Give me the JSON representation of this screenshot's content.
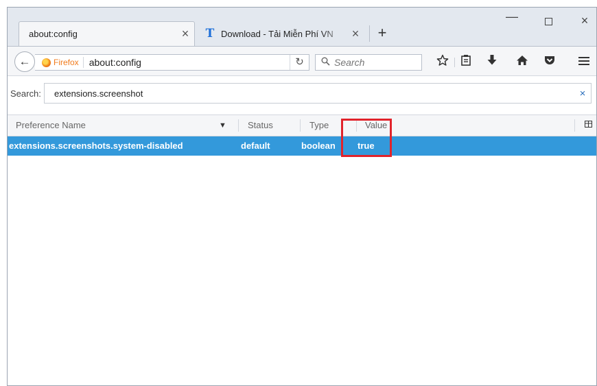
{
  "tabs": [
    {
      "title": "about:config",
      "close_glyph": "×",
      "active": true
    },
    {
      "title": "Download - Tải Miễn Phí VN",
      "favicon": "T",
      "close_glyph": "×",
      "active": false
    }
  ],
  "new_tab_glyph": "+",
  "window_controls": {
    "minimize": "—",
    "close": "×"
  },
  "navbar": {
    "back_glyph": "←",
    "identity_label": "Firefox",
    "url": "about:config",
    "reload_glyph": "↻",
    "search_placeholder": "Search",
    "icons": [
      "star-icon",
      "reading-list-icon",
      "download-icon",
      "home-icon",
      "pocket-icon",
      "menu-icon"
    ]
  },
  "config": {
    "filter_label": "Search:",
    "filter_value": "extensions.screenshot",
    "clear_glyph": "×",
    "columns": {
      "name": "Preference Name",
      "status": "Status",
      "type": "Type",
      "value": "Value"
    },
    "rows": [
      {
        "name": "extensions.screenshots.system-disabled",
        "status": "default",
        "type": "boolean",
        "value": "true"
      }
    ]
  },
  "colors": {
    "selected_row": "#3399db",
    "annotation": "#e1232b",
    "identity": "#f17b1c"
  }
}
